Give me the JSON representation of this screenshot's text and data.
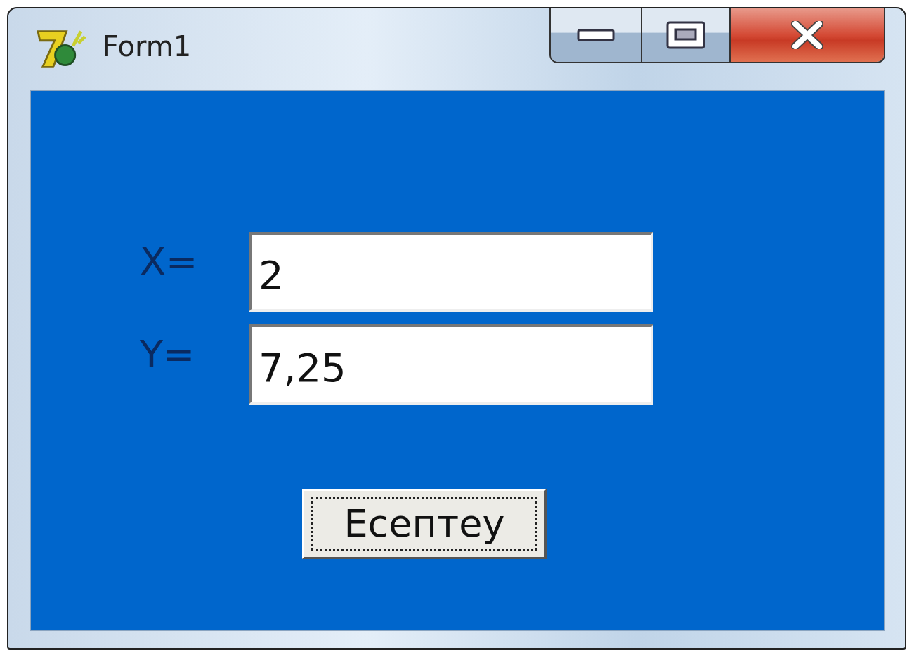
{
  "window": {
    "title": "Form1"
  },
  "fields": [
    {
      "label": "X=",
      "value": "2"
    },
    {
      "label": "Y=",
      "value": "7,25"
    }
  ],
  "button": {
    "label": "Есептеу",
    "focused": true
  }
}
